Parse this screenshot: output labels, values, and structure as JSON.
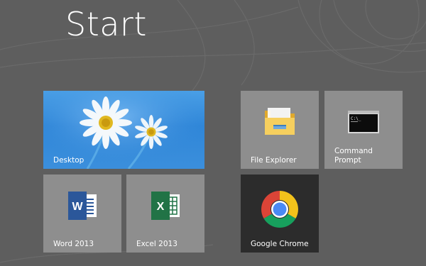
{
  "screen": {
    "title": "Start",
    "background_color": "#5e5e5e"
  },
  "tiles": [
    {
      "label": "Desktop",
      "icon": "desktop-wallpaper-daisies",
      "color": "#3b8fdc"
    },
    {
      "label": "File Explorer",
      "icon": "folder-icon",
      "color": "#8e8e8e"
    },
    {
      "label_line1": "Command",
      "label_line2": "Prompt",
      "icon": "terminal-icon",
      "color": "#8e8e8e"
    },
    {
      "label": "Word 2013",
      "icon": "word-icon",
      "color": "#8e8e8e"
    },
    {
      "label": "Excel 2013",
      "icon": "excel-icon",
      "color": "#8e8e8e"
    },
    {
      "label": "Google Chrome",
      "icon": "chrome-icon",
      "color": "#2c2c2c"
    }
  ]
}
